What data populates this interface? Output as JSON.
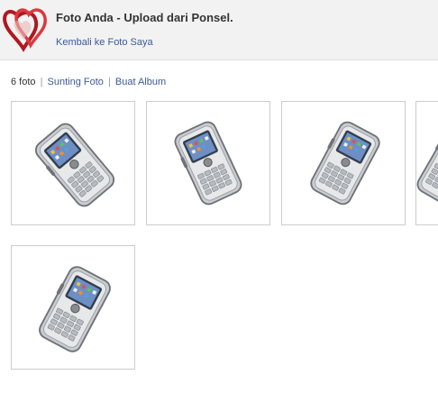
{
  "header": {
    "title": "Foto Anda - Upload dari Ponsel.",
    "back_link": "Kembali ke Foto Saya",
    "avatar_icon": "hearts-icon"
  },
  "toolbar": {
    "count": "6 foto",
    "separator": "|",
    "edit_link": "Sunting Foto",
    "album_link": "Buat Album"
  },
  "photos": [
    {
      "subject": "blackberry-phone"
    },
    {
      "subject": "blackberry-phone"
    },
    {
      "subject": "blackberry-phone"
    },
    {
      "subject": "blackberry-phone"
    },
    {
      "subject": "blackberry-phone"
    }
  ],
  "colors": {
    "link": "#3b5998",
    "header_bg": "#f2f2f2",
    "thumb_border": "#cccccc",
    "heart_red": "#c8202a"
  }
}
